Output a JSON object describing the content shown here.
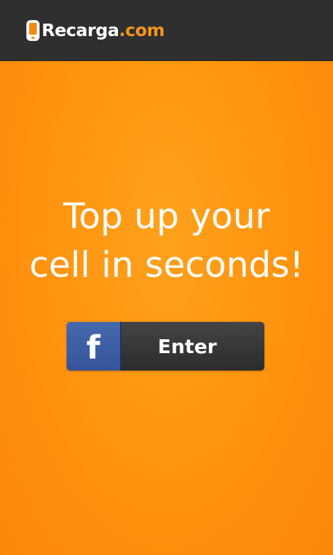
{
  "header": {
    "logo_main": "Recarga",
    "logo_suffix": ".com",
    "logo_icon": "phone-icon"
  },
  "main": {
    "headline_line1": "Top up your",
    "headline_line2": "cell in seconds!",
    "facebook_button": {
      "icon": "facebook-f-icon",
      "icon_glyph": "f",
      "label": "Enter"
    }
  },
  "colors": {
    "background": "#ff9510",
    "topbar": "#2f2f2f",
    "accent": "#f7941d",
    "facebook_blue": "#3b5998",
    "button_dark": "#333333"
  }
}
